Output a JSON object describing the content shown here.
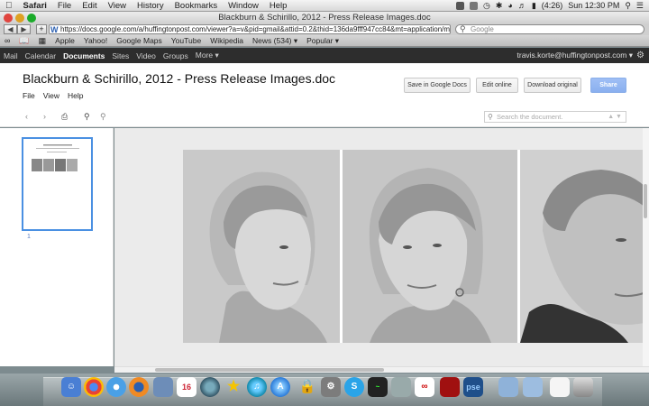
{
  "menubar": {
    "apple": "",
    "items": [
      "Safari",
      "File",
      "Edit",
      "View",
      "History",
      "Bookmarks",
      "Window",
      "Help"
    ],
    "battery": "(4:26)",
    "clock": "Sun 12:30 PM"
  },
  "window": {
    "title": "Blackburn & Schirillo, 2012 - Press Release Images.doc"
  },
  "browser": {
    "url": "https://docs.google.com/a/huffingtonpost.com/viewer?a=v&pid=gmail&attid=0.2&thid=136da9fff947cc84&mt=application/m",
    "search_placeholder": "Google",
    "bookmarks": [
      "Apple",
      "Yahoo!",
      "Google Maps",
      "YouTube",
      "Wikipedia",
      "News (534) ▾",
      "Popular ▾"
    ]
  },
  "google_bar": {
    "items": [
      "Mail",
      "Calendar",
      "Documents",
      "Sites",
      "Video",
      "Groups",
      "More ▾"
    ],
    "selected": "Documents",
    "account": "travis.korte@huffingtonpost.com ▾"
  },
  "doc": {
    "title": "Blackburn & Schirillo, 2012 - Press Release Images.doc",
    "menu": [
      "File",
      "View",
      "Help"
    ],
    "buttons": {
      "save": "Save in Google Docs",
      "edit": "Edit online",
      "download": "Download original",
      "share": "Share"
    },
    "search_placeholder": "Search the document.",
    "page_number": "1"
  },
  "colors": {
    "gbar": "#2d2d2d",
    "share_button": "#8ab0ef",
    "thumb_border": "#4a90e2"
  },
  "icons": [
    "apple-icon",
    "back-icon",
    "forward-icon",
    "add-bookmark-icon",
    "search-icon",
    "reading-list-icon",
    "print-icon",
    "zoom-in-icon",
    "zoom-out-icon",
    "gear-icon"
  ],
  "dock_apps": [
    "Finder",
    "Chrome",
    "Safari",
    "Firefox",
    "Preview",
    "iCal",
    "Time Machine",
    "AIM",
    "iTunes",
    "App Store",
    "Keychain",
    "System Preferences",
    "Skype",
    "Activity Monitor",
    "Photo Viewer",
    "Acrobat",
    "Acrobat Pro",
    "Photoshop",
    "Folder",
    "Downloads",
    "TextEdit",
    "Trash"
  ],
  "dock_labels": {
    "ical_day": "16",
    "pse": "pse"
  }
}
